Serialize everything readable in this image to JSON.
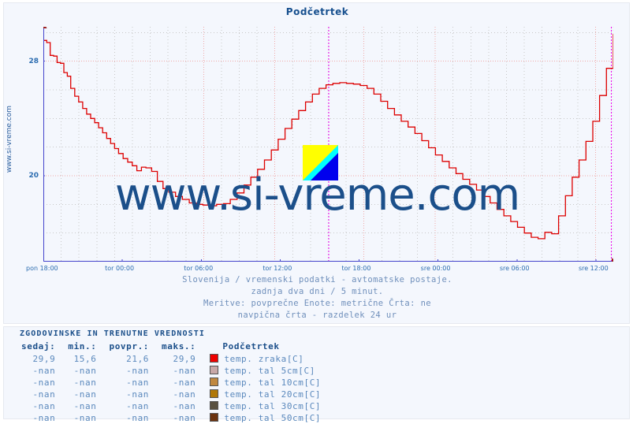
{
  "chart": {
    "title": "Podčetrtek",
    "side_watermark": "www.si-vreme.com",
    "big_watermark": "www.si-vreme.com",
    "logo_name": "si-vreme-logo",
    "caption_lines": [
      "Slovenija / vremenski podatki - avtomatske postaje.",
      "zadnja dva dni / 5 minut.",
      "Meritve: povprečne  Enote: metrične  Črta: ne",
      "navpična črta - razdelek 24 ur"
    ]
  },
  "colors": {
    "series_air": "#dd0000",
    "grid_major": "#f0a8a8",
    "grid_minor": "#c8c8c8",
    "axis": "#4444cc",
    "marker_line": "#ee00ee",
    "title": "#17508f",
    "label": "#2b6cb0",
    "panel_bg": "#f4f7fd"
  },
  "table": {
    "heading": "ZGODOVINSKE IN TRENUTNE VREDNOSTI",
    "columns": [
      "sedaj:",
      "min.:",
      "povpr.:",
      "maks.:",
      "Podčetrtek"
    ],
    "rows": [
      {
        "sedaj": "29,9",
        "min": "15,6",
        "povpr": "21,6",
        "maks": "29,9",
        "name": "temp. zraka[C]",
        "color": "#ee0000"
      },
      {
        "sedaj": "-nan",
        "min": "-nan",
        "povpr": "-nan",
        "maks": "-nan",
        "name": "temp. tal  5cm[C]",
        "color": "#c8a8a8"
      },
      {
        "sedaj": "-nan",
        "min": "-nan",
        "povpr": "-nan",
        "maks": "-nan",
        "name": "temp. tal 10cm[C]",
        "color": "#c08840"
      },
      {
        "sedaj": "-nan",
        "min": "-nan",
        "povpr": "-nan",
        "maks": "-nan",
        "name": "temp. tal 20cm[C]",
        "color": "#b07808"
      },
      {
        "sedaj": "-nan",
        "min": "-nan",
        "povpr": "-nan",
        "maks": "-nan",
        "name": "temp. tal 30cm[C]",
        "color": "#585040"
      },
      {
        "sedaj": "-nan",
        "min": "-nan",
        "povpr": "-nan",
        "maks": "-nan",
        "name": "temp. tal 50cm[C]",
        "color": "#6b3310"
      }
    ]
  },
  "chart_data": {
    "type": "line",
    "title": "Podčetrtek",
    "xlabel": "",
    "ylabel": "",
    "grid": true,
    "legend_position": "below-table",
    "ylim": [
      14.0,
      30.4
    ],
    "yticks": [
      20,
      28
    ],
    "ytick_labels": [
      "20",
      "28"
    ],
    "xtick_labels": [
      "pon 18:00",
      "tor 00:00",
      "tor 06:00",
      "tor 12:00",
      "tor 18:00",
      "sre 00:00",
      "sre 06:00",
      "sre 12:00"
    ],
    "xtick_positions": [
      0.0,
      0.1385,
      0.277,
      0.4155,
      0.554,
      0.6925,
      0.831,
      0.9695
    ],
    "vertical_marker_lines": [
      0.5007,
      0.9965
    ],
    "vertical_marker_note": "navpična črta - razdelek 24 ur",
    "series": [
      {
        "name": "temp. zraka[C]",
        "color": "#dd0000",
        "unit": "C",
        "now": 29.9,
        "min": 15.6,
        "avg": 21.6,
        "max": 29.9,
        "x": [
          0.0,
          0.006,
          0.012,
          0.018,
          0.024,
          0.03,
          0.036,
          0.042,
          0.048,
          0.055,
          0.062,
          0.069,
          0.076,
          0.083,
          0.09,
          0.097,
          0.104,
          0.111,
          0.118,
          0.125,
          0.132,
          0.14,
          0.148,
          0.156,
          0.164,
          0.172,
          0.18,
          0.19,
          0.2,
          0.21,
          0.22,
          0.232,
          0.244,
          0.256,
          0.268,
          0.28,
          0.292,
          0.304,
          0.316,
          0.328,
          0.34,
          0.352,
          0.364,
          0.376,
          0.388,
          0.4,
          0.412,
          0.424,
          0.436,
          0.448,
          0.46,
          0.472,
          0.484,
          0.496,
          0.508,
          0.52,
          0.532,
          0.544,
          0.556,
          0.568,
          0.58,
          0.592,
          0.604,
          0.616,
          0.628,
          0.64,
          0.652,
          0.664,
          0.676,
          0.688,
          0.7,
          0.712,
          0.724,
          0.736,
          0.748,
          0.76,
          0.772,
          0.784,
          0.796,
          0.808,
          0.82,
          0.832,
          0.844,
          0.856,
          0.868,
          0.88,
          0.892,
          0.904,
          0.916,
          0.928,
          0.94,
          0.952,
          0.964,
          0.976,
          0.988,
          1.0
        ],
        "y": [
          29.45,
          29.3,
          28.4,
          28.35,
          27.9,
          27.85,
          27.2,
          26.95,
          26.1,
          25.55,
          25.15,
          24.7,
          24.3,
          24.0,
          23.7,
          23.35,
          23.0,
          22.6,
          22.25,
          21.9,
          21.55,
          21.2,
          20.95,
          20.7,
          20.35,
          20.6,
          20.55,
          20.3,
          19.6,
          19.1,
          18.85,
          18.55,
          18.35,
          18.1,
          18.0,
          17.95,
          17.9,
          18.0,
          18.05,
          18.35,
          18.8,
          19.35,
          19.9,
          20.45,
          21.1,
          21.8,
          22.55,
          23.3,
          23.95,
          24.55,
          25.15,
          25.7,
          26.1,
          26.35,
          26.45,
          26.5,
          26.45,
          26.4,
          26.3,
          26.1,
          25.7,
          25.2,
          24.7,
          24.25,
          23.8,
          23.4,
          22.95,
          22.45,
          21.95,
          21.45,
          21.0,
          20.55,
          20.15,
          19.75,
          19.4,
          19.0,
          18.55,
          18.1,
          17.65,
          17.2,
          16.8,
          16.4,
          16.0,
          15.7,
          15.6,
          16.05,
          15.95,
          17.2,
          18.6,
          19.9,
          21.1,
          22.4,
          23.8,
          25.6,
          27.5,
          29.0
        ],
        "y_end": 29.9
      }
    ]
  }
}
